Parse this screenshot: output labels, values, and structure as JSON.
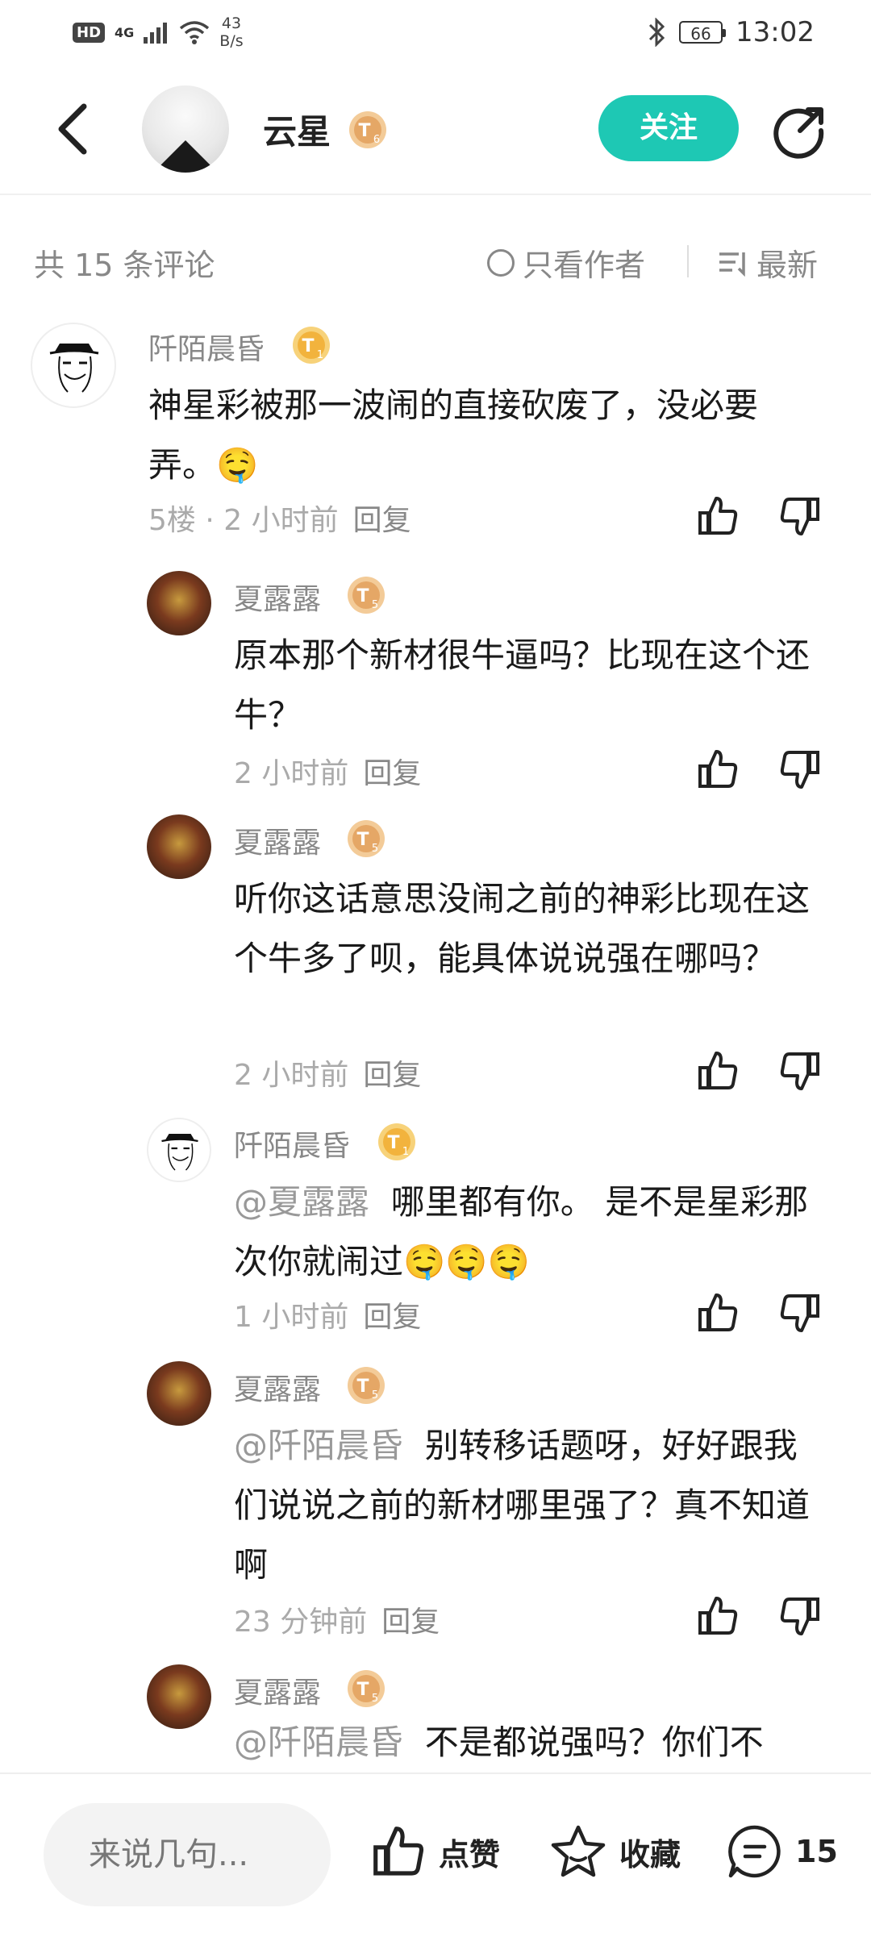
{
  "status_bar": {
    "hd": "HD",
    "network": "4G",
    "speed_value": "43",
    "speed_unit": "B/s",
    "battery": "66",
    "time": "13:02"
  },
  "header": {
    "author_name": "云星",
    "follow_label": "关注"
  },
  "toolbar": {
    "count_text": "共 15 条评论",
    "only_author": "只看作者",
    "sort": "最新"
  },
  "comments": [
    {
      "name": "阡陌晨昏",
      "text": "神星彩被那一波闹的直接砍废了，没必要弄。",
      "emoji": "🤤",
      "meta": "5楼 · 2 小时前",
      "reply": "回复"
    },
    {
      "name": "夏露露",
      "text": "原本那个新材很牛逼吗？比现在这个还牛？",
      "meta": "2 小时前",
      "reply": "回复"
    },
    {
      "name": "夏露露",
      "text": "听你这话意思没闹之前的神彩比现在这个牛多了呗，能具体说说强在哪吗？",
      "meta": "2 小时前",
      "reply": "回复"
    },
    {
      "name": "阡陌晨昏",
      "mention": "@夏露露",
      "text": "哪里都有你。 是不是星彩那次你就闹过",
      "emoji": "🤤🤤🤤",
      "meta": "1 小时前",
      "reply": "回复"
    },
    {
      "name": "夏露露",
      "mention": "@阡陌晨昏",
      "text": "别转移话题呀，好好跟我们说说之前的新材哪里强了？真不知道啊",
      "meta": "23 分钟前",
      "reply": "回复"
    },
    {
      "name": "夏露露",
      "mention": "@阡陌晨昏",
      "text": "不是都说强吗？你们不"
    }
  ],
  "bottom_bar": {
    "input_placeholder": "来说几句...",
    "like": "点赞",
    "favorite": "收藏",
    "comment_count": "15"
  },
  "colors": {
    "accent": "#1ec8b4",
    "badge_gold": "#f2b33d",
    "badge_tan": "#e9b98a"
  }
}
